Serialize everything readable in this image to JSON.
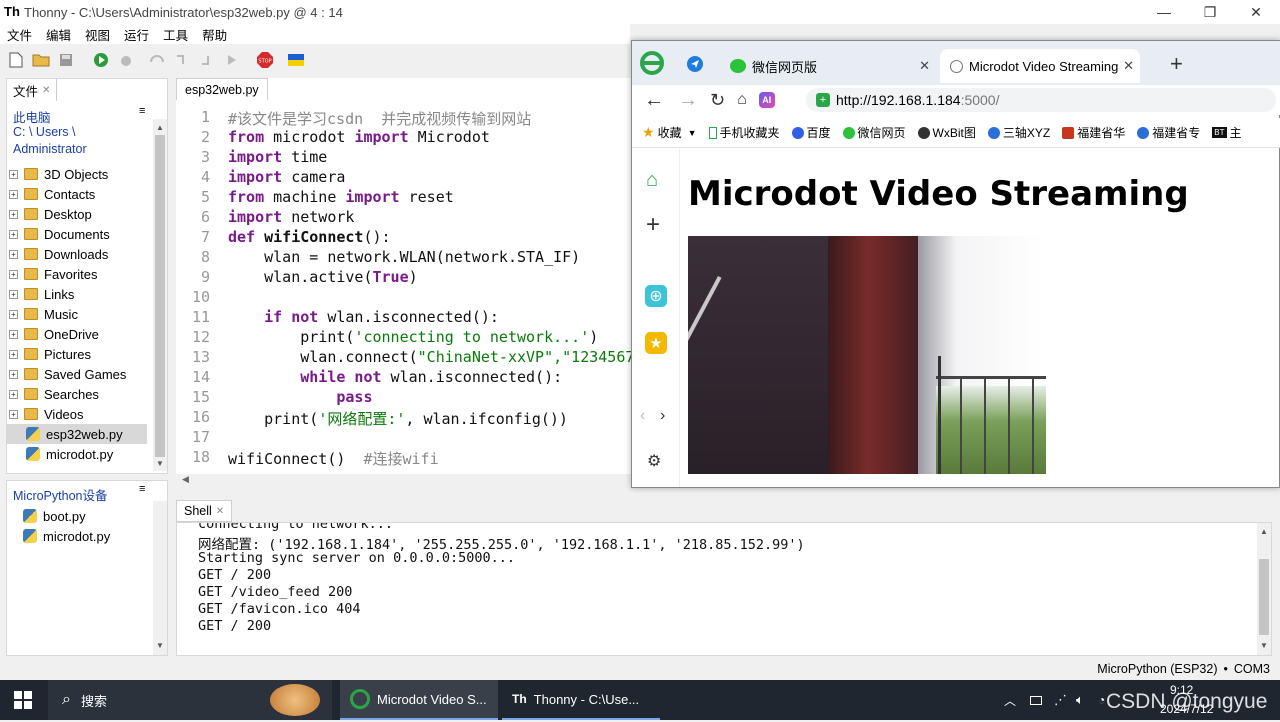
{
  "thonny": {
    "title": "Thonny  -  C:\\Users\\Administrator\\esp32web.py  @  4 : 14",
    "menu": [
      "文件",
      "编辑",
      "视图",
      "运行",
      "工具",
      "帮助"
    ],
    "files_tab": "文件",
    "this_pc": "此电脑",
    "path_line1": "C: \\ Users \\",
    "path_line2": "Administrator",
    "tree": [
      {
        "label": "3D Objects",
        "type": "folder"
      },
      {
        "label": "Contacts",
        "type": "folder"
      },
      {
        "label": "Desktop",
        "type": "folder"
      },
      {
        "label": "Documents",
        "type": "folder"
      },
      {
        "label": "Downloads",
        "type": "folder"
      },
      {
        "label": "Favorites",
        "type": "folder"
      },
      {
        "label": "Links",
        "type": "folder"
      },
      {
        "label": "Music",
        "type": "folder"
      },
      {
        "label": "OneDrive",
        "type": "folder"
      },
      {
        "label": "Pictures",
        "type": "folder"
      },
      {
        "label": "Saved Games",
        "type": "folder"
      },
      {
        "label": "Searches",
        "type": "folder"
      },
      {
        "label": "Videos",
        "type": "folder"
      },
      {
        "label": "esp32web.py",
        "type": "py",
        "selected": true
      },
      {
        "label": "microdot.py",
        "type": "py"
      }
    ],
    "device_title": "MicroPython设备",
    "device_files": [
      "boot.py",
      "microdot.py"
    ],
    "editor_tab": "esp32web.py",
    "shell_tab": "Shell",
    "shell_lines": [
      "connecting to network...",
      "网络配置: ('192.168.1.184', '255.255.255.0', '192.168.1.1', '218.85.152.99')",
      "Starting sync server on 0.0.0.0:5000...",
      "GET / 200",
      "GET /video_feed 200",
      "GET /favicon.ico 404",
      "GET / 200"
    ],
    "status_interpreter": "MicroPython (ESP32)",
    "status_sep": "•",
    "status_port": "COM3"
  },
  "code_lines": [
    "1",
    "2",
    "3",
    "4",
    "5",
    "6",
    "7",
    "8",
    "9",
    "10",
    "11",
    "12",
    "13",
    "14",
    "15",
    "16",
    "17",
    "18"
  ],
  "code": {
    "l1": "#该文件是学习csdn  并完成视频传输到网站",
    "l2_kw1": "from",
    "l2_mid": " microdot ",
    "l2_kw2": "import",
    "l2_rest": " Microdot",
    "l3_kw": "import",
    "l3_rest": " time",
    "l4_kw": "import",
    "l4_rest": " camera",
    "l5_kw1": "from",
    "l5_mid": " machine ",
    "l5_kw2": "import",
    "l5_rest": " reset",
    "l6_kw": "import",
    "l6_rest": " network",
    "l7_kw": "def",
    "l7_name": " wifiConnect",
    "l7_rest": "():",
    "l8": "    wlan = network.WLAN(network.STA_IF)",
    "l9_a": "    wlan.active(",
    "l9_b": "True",
    "l9_c": ")",
    "l11_a": "    ",
    "l11_kw1": "if",
    "l11_kw2": " not",
    "l11_rest": " wlan.isconnected():",
    "l12_a": "        print(",
    "l12_s": "'connecting to network...'",
    "l12_c": ")",
    "l13_a": "        wlan.connect(",
    "l13_s": "\"ChinaNet-xxVP\",\"1234567",
    "l14_a": "        ",
    "l14_kw1": "while",
    "l14_kw2": " not",
    "l14_rest": " wlan.isconnected():",
    "l15_a": "            ",
    "l15_kw": "pass",
    "l16_a": "    print(",
    "l16_s": "'网络配置:'",
    "l16_c": ", wlan.ifconfig())",
    "l18_a": "wifiConnect()  ",
    "l18_cm": "#连接wifi"
  },
  "browser": {
    "tab1": "微信网页版",
    "tab2": "Microdot Video Streaming",
    "url_host": "http://192.168.1.184",
    "url_port": ":5000/",
    "bookmarks": [
      "收藏",
      "手机收藏夹",
      "百度",
      "微信网页",
      "WxBit图",
      "三轴XYZ",
      "福建省华",
      "福建省专",
      "主"
    ],
    "page_title": "Microdot Video Streaming"
  },
  "taskbar": {
    "search": "搜索",
    "app1": "Microdot Video S...",
    "app2": "Thonny  -  C:\\Use...",
    "time": "9:12",
    "date": "2024/7/12",
    "watermark": "CSDN @tongyue"
  }
}
